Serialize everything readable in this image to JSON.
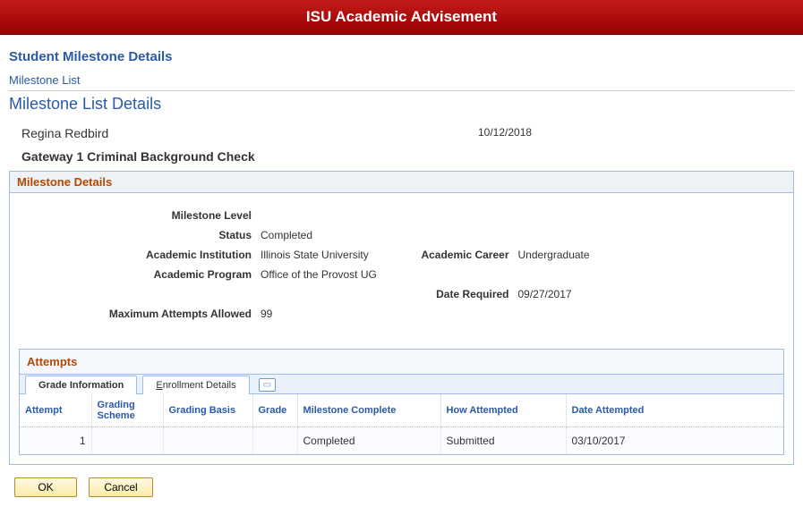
{
  "banner": {
    "title": "ISU Academic Advisement"
  },
  "header": {
    "page_title": "Student Milestone Details"
  },
  "breadcrumb": {
    "milestone_list_link": "Milestone List"
  },
  "section": {
    "title": "Milestone List Details"
  },
  "student": {
    "name": "Regina Redbird",
    "date": "10/12/2018",
    "milestone_name": "Gateway 1 Criminal Background Check"
  },
  "details": {
    "panel_title": "Milestone Details",
    "labels": {
      "milestone_level": "Milestone Level",
      "status": "Status",
      "academic_institution": "Academic Institution",
      "academic_career": "Academic Career",
      "academic_program": "Academic Program",
      "date_required": "Date Required",
      "max_attempts": "Maximum Attempts Allowed"
    },
    "values": {
      "milestone_level": "",
      "status": "Completed",
      "academic_institution": "Illinois State University",
      "academic_career": "Undergraduate",
      "academic_program": "Office of the Provost UG",
      "date_required": "09/27/2017",
      "max_attempts": "99"
    }
  },
  "attempts": {
    "panel_title": "Attempts",
    "tabs": {
      "grade_information": "Grade Information",
      "enrollment_details": "Enrollment Details",
      "enrollment_details_prefix": "E",
      "enrollment_details_rest": "nrollment Details"
    },
    "columns": {
      "attempt": "Attempt",
      "grading_scheme": "Grading Scheme",
      "grading_basis": "Grading Basis",
      "grade": "Grade",
      "milestone_complete": "Milestone Complete",
      "how_attempted": "How Attempted",
      "date_attempted": "Date Attempted"
    },
    "rows": [
      {
        "attempt": "1",
        "grading_scheme": "",
        "grading_basis": "",
        "grade": "",
        "milestone_complete": "Completed",
        "how_attempted": "Submitted",
        "date_attempted": "03/10/2017"
      }
    ]
  },
  "buttons": {
    "ok": "OK",
    "cancel": "Cancel"
  }
}
